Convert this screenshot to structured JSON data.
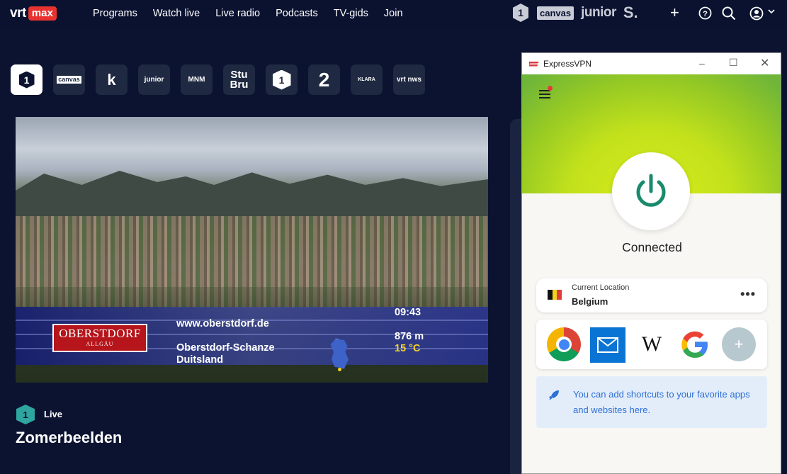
{
  "app": {
    "logo_main": "vrt",
    "logo_badge": "max"
  },
  "nav": {
    "links": [
      "Programs",
      "Watch live",
      "Live radio",
      "Podcasts",
      "TV-gids",
      "Join"
    ],
    "brands": {
      "one": "1",
      "canvas": "canvas",
      "junior": "junior",
      "s": "S."
    },
    "icons": [
      "plus-icon",
      "help-icon",
      "search-icon",
      "user-icon",
      "chevron-down-icon"
    ]
  },
  "channels": [
    {
      "label": "1",
      "name": "een",
      "active": true
    },
    {
      "label": "canvas",
      "name": "canvas"
    },
    {
      "label": "k",
      "name": "ketnet"
    },
    {
      "label": "junior",
      "name": "ketnet-junior"
    },
    {
      "label": "MNM",
      "name": "mnm"
    },
    {
      "label": "Stu Bru",
      "name": "stubru"
    },
    {
      "label": "1",
      "name": "radio1"
    },
    {
      "label": "2",
      "name": "radio2"
    },
    {
      "label": "KLARA",
      "name": "klara"
    },
    {
      "label": "vrt nws",
      "name": "vrt-nws"
    }
  ],
  "video": {
    "logo_line1": "OBERSTDORF",
    "logo_line2": "ALLGÄU",
    "url": "www.oberstdorf.de",
    "time": "09:43",
    "altitude": "876 m",
    "temperature": "15 °C",
    "location_line1": "Oberstdorf-Schanze",
    "location_line2": "Duitsland"
  },
  "now_playing": {
    "channel_icon": "1",
    "status": "Live",
    "title": "Zomerbeelden"
  },
  "vpn": {
    "window_title": "ExpressVPN",
    "status": "Connected",
    "location_label": "Current Location",
    "location_value": "Belgium",
    "more": "•••",
    "shortcuts": [
      {
        "name": "chrome-shortcut"
      },
      {
        "name": "mail-shortcut"
      },
      {
        "name": "wikipedia-shortcut",
        "label": "W"
      },
      {
        "name": "google-shortcut",
        "label": "G"
      },
      {
        "name": "add-shortcut",
        "label": "+"
      }
    ],
    "hint": "You can add shortcuts to your favorite apps and websites here.",
    "colors": {
      "accent": "#da3940",
      "power": "#1a8a6c",
      "hint_text": "#2d6fd6"
    }
  }
}
